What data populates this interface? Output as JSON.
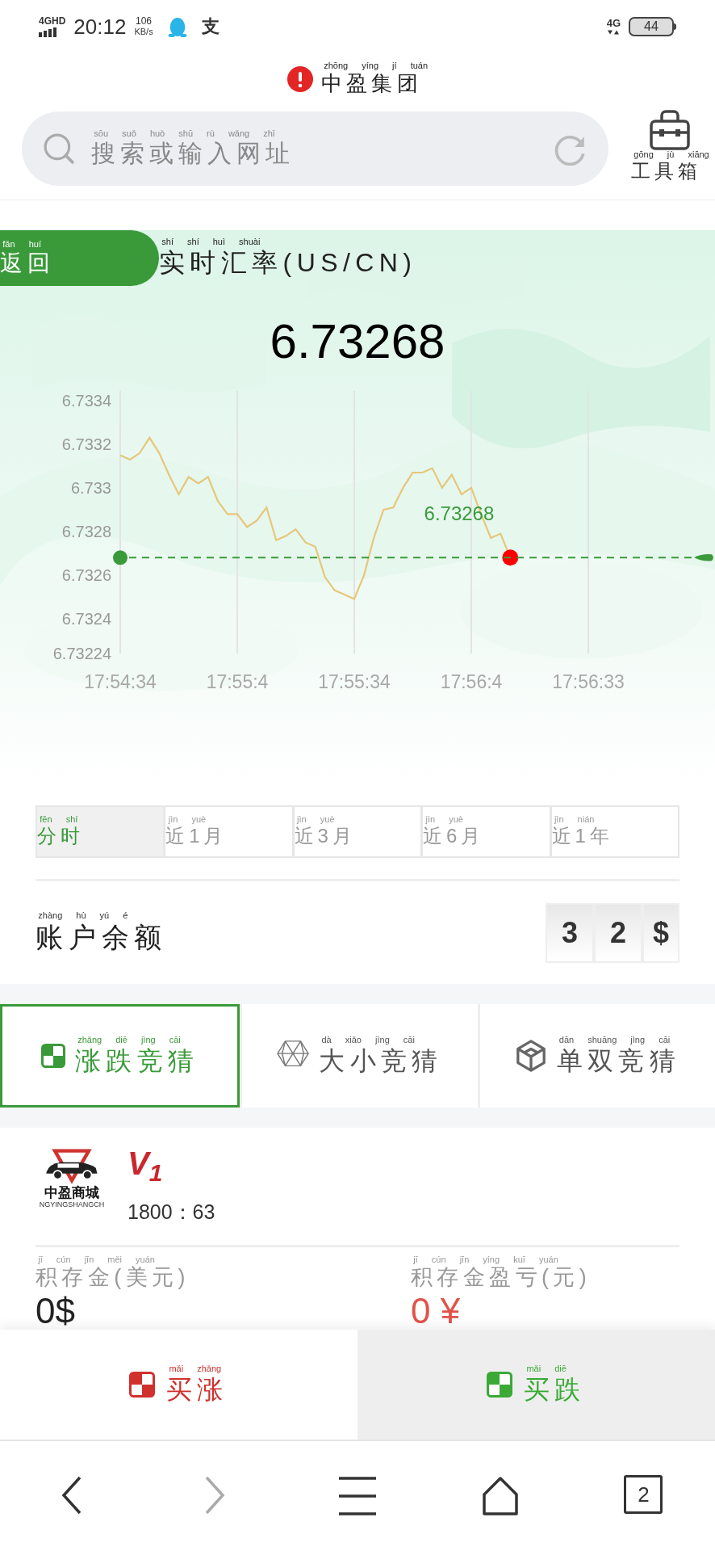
{
  "status_bar": {
    "network": "4GHD",
    "time": "20:12",
    "speed": "106",
    "speed_unit": "KB/s",
    "app_glyph": "支",
    "right_network": "4G",
    "battery": "44"
  },
  "title": {
    "text": "中盈集团",
    "pinyin": "zhōng yíng jí tuán"
  },
  "search": {
    "placeholder": {
      "text": "搜索或输入网址",
      "pinyin": "sōu suǒ huò shū rù wǎng zhǐ"
    }
  },
  "toolbox": {
    "text": "工具箱",
    "pinyin": "gōng jù xiāng"
  },
  "back_button": {
    "text": "返回",
    "pinyin": "fǎn huí"
  },
  "rate": {
    "title": {
      "text": "实时汇率(US/CN)",
      "pinyin": "shí shí huì shuài"
    },
    "value": "6.73268",
    "chart_data": {
      "type": "line",
      "categories": [
        "17:54:34",
        null,
        null,
        null,
        null,
        null,
        null,
        null,
        null,
        null,
        null,
        null,
        "17:55:4",
        null,
        null,
        null,
        null,
        null,
        null,
        null,
        null,
        null,
        null,
        null,
        "17:55:34",
        null,
        null,
        null,
        null,
        null,
        null,
        null,
        null,
        null,
        null,
        null,
        "17:56:4",
        null,
        null,
        null,
        null,
        null,
        null,
        null,
        null,
        null,
        null,
        null,
        "17:56:33"
      ],
      "series": [
        {
          "color": "#e6c77a",
          "values": [
            6.73315,
            6.73313,
            6.73316,
            6.73323,
            6.73316,
            6.73306,
            6.73297,
            6.73305,
            6.73302,
            6.73305,
            6.73294,
            6.73288,
            6.73288,
            6.73282,
            6.73285,
            6.73291,
            6.73276,
            6.73278,
            6.73281,
            6.73275,
            6.73273,
            6.73259,
            6.73253,
            6.73251,
            6.73249,
            6.7326,
            6.73277,
            6.7329,
            6.73291,
            6.733,
            6.73307,
            6.73307,
            6.73309,
            6.733,
            6.73306,
            6.73297,
            6.733,
            6.73288,
            6.73277,
            6.73279,
            6.73268,
            null,
            null,
            null,
            null,
            null,
            null,
            null,
            null
          ]
        }
      ],
      "ylim": [
        6.73224,
        6.7334
      ],
      "yticks": [
        {
          "value": 6.7334,
          "label": "6.7334"
        },
        {
          "value": 6.7332,
          "label": "6.7332"
        },
        {
          "value": 6.733,
          "label": "6.733"
        },
        {
          "value": 6.7328,
          "label": "6.7328"
        },
        {
          "value": 6.7326,
          "label": "6.7326"
        },
        {
          "value": 6.7324,
          "label": "6.7324"
        },
        {
          "value": 6.73224,
          "label": "6.73224"
        }
      ],
      "grid": true,
      "ref_lines": [
        {
          "axis": "y",
          "value": 6.73268
        }
      ],
      "annotations": [
        "6.73268"
      ]
    }
  },
  "periods": [
    {
      "text": "分时",
      "pinyin": "fēn shí",
      "selected": true
    },
    {
      "text": "近1月",
      "pinyin": "jìn yuè",
      "selected": false
    },
    {
      "text": "近3月",
      "pinyin": "jìn yuè",
      "selected": false
    },
    {
      "text": "近6月",
      "pinyin": "jìn yuè",
      "selected": false
    },
    {
      "text": "近1年",
      "pinyin": "jìn nián",
      "selected": false
    }
  ],
  "balance": {
    "label": {
      "text": "账户余额",
      "pinyin": "zhàng hù yú é"
    },
    "digits": [
      "3",
      "2",
      "$"
    ]
  },
  "games": [
    {
      "kind": "updown",
      "text": "涨跌竞猜",
      "pinyin": "zhǎng diē jìng cāi",
      "selected": true
    },
    {
      "kind": "bigsmall",
      "text": "大小竞猜",
      "pinyin": "dà xiǎo jìng cāi",
      "selected": false
    },
    {
      "kind": "oddeven",
      "text": "单双竞猜",
      "pinyin": "dān shuāng jìng cāi",
      "selected": false
    }
  ],
  "member": {
    "logo_text": "中盈商城",
    "logo_subtitle": "NGYINGSHANGCH",
    "level": "V$_{1}$",
    "ratio": "1800：63"
  },
  "stats": [
    {
      "label": {
        "text": "积存金(美元)",
        "pinyin": "jī cún jīn měi yuán"
      },
      "value": "0$",
      "color": "#222222"
    },
    {
      "label": {
        "text": "积存金盈亏(元)",
        "pinyin": "jī cún jīn yíng kuī yuán"
      },
      "value": "0 ¥",
      "color": "#e0534a"
    }
  ],
  "actions": [
    {
      "kind": "up",
      "text": "买涨",
      "pinyin": "mǎi zhǎng",
      "color": "#d0312d"
    },
    {
      "kind": "down",
      "text": "买跌",
      "pinyin": "mǎi diē",
      "color": "#3aaa35"
    }
  ],
  "nav": [
    {
      "kind": "back",
      "disabled": false
    },
    {
      "kind": "forward",
      "disabled": true
    },
    {
      "kind": "menu",
      "disabled": false
    },
    {
      "kind": "home",
      "disabled": false
    },
    {
      "kind": "tabs",
      "count": "2",
      "disabled": false
    }
  ]
}
